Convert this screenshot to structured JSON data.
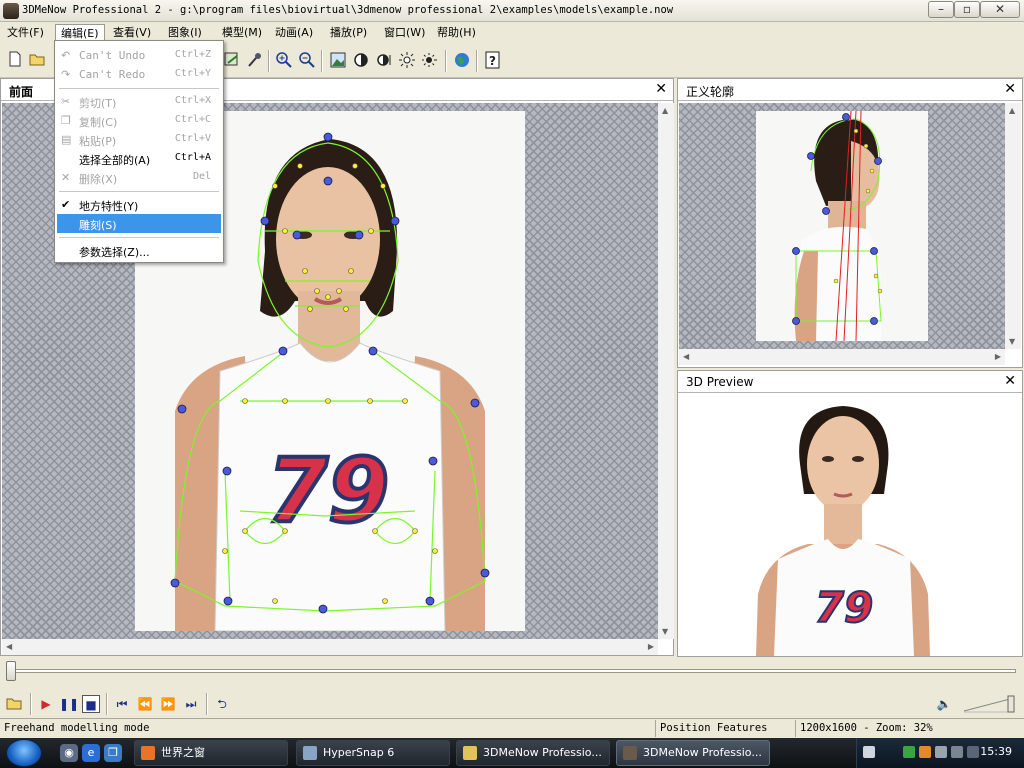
{
  "window": {
    "title": "3DMeNow Professional 2 - g:\\program files\\biovirtual\\3dmenow professional 2\\examples\\models\\example.now"
  },
  "menubar": [
    {
      "label": "文件(F)"
    },
    {
      "label": "编辑(E)"
    },
    {
      "label": "查看(V)"
    },
    {
      "label": "图象(I)"
    },
    {
      "label": "模型(M)"
    },
    {
      "label": "动画(A)"
    },
    {
      "label": "播放(P)"
    },
    {
      "label": "窗口(W)"
    },
    {
      "label": "帮助(H)"
    }
  ],
  "edit_menu": {
    "items": [
      {
        "label": "Can't Undo",
        "shortcut": "Ctrl+Z",
        "enabled": false,
        "icon": "undo-icon"
      },
      {
        "label": "Can't Redo",
        "shortcut": "Ctrl+Y",
        "enabled": false,
        "icon": "redo-icon"
      },
      {
        "label": "剪切(T)",
        "shortcut": "Ctrl+X",
        "enabled": false,
        "icon": "cut-icon"
      },
      {
        "label": "复制(C)",
        "shortcut": "Ctrl+C",
        "enabled": false,
        "icon": "copy-icon"
      },
      {
        "label": "粘贴(P)",
        "shortcut": "Ctrl+V",
        "enabled": false,
        "icon": "paste-icon"
      },
      {
        "label": "选择全部的(A)",
        "shortcut": "Ctrl+A",
        "enabled": true
      },
      {
        "label": "删除(X)",
        "shortcut": "Del",
        "enabled": false,
        "icon": "delete-icon"
      },
      {
        "label": "地方特性(Y)",
        "checked": true,
        "enabled": true
      },
      {
        "label": "雕刻(S)",
        "highlighted": true,
        "enabled": true
      },
      {
        "label": "参数选择(Z)...",
        "enabled": true
      }
    ]
  },
  "toolbar": {
    "icons": [
      "new-file-icon",
      "open-file-icon",
      "sculpt-tool-icon",
      "pin-tool-icon",
      "zoom-in-icon",
      "zoom-out-icon",
      "image-icon",
      "contrast-icon",
      "brightness-icon",
      "light-icon",
      "light-alt-icon",
      "globe-icon",
      "help-icon"
    ]
  },
  "panels": {
    "front": {
      "title": "前面"
    },
    "profile": {
      "title": "正义轮廓"
    },
    "preview": {
      "title": "3D Preview"
    }
  },
  "photo": {
    "jersey_number": "79"
  },
  "statusbar": {
    "mode": "Freehand modelling mode",
    "features": "Position Features",
    "size_zoom": "1200x1600 - Zoom: 32%"
  },
  "taskbar": {
    "tasks": [
      {
        "label": "世界之窗"
      },
      {
        "label": "HyperSnap 6"
      },
      {
        "label": "3DMeNow Professio..."
      },
      {
        "label": "3DMeNow Professio..."
      }
    ],
    "clock": "15:39"
  }
}
